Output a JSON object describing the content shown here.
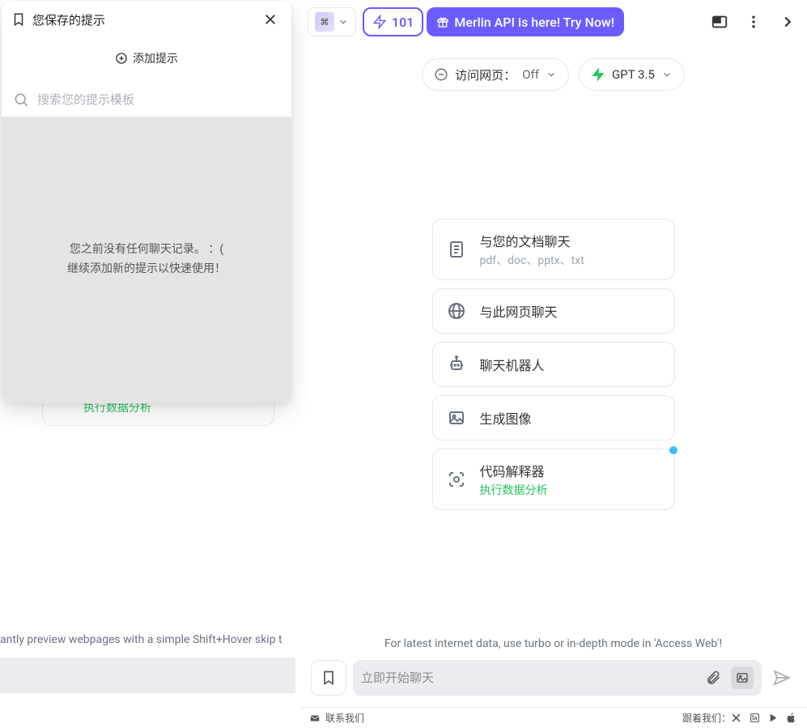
{
  "popup": {
    "title": "您保存的提示",
    "add_label": "添加提示",
    "search_placeholder": "搜索您的提示模板",
    "empty_line1": "您之前没有任何聊天记录。 ：(",
    "empty_line2": "继续添加新的提示以快速使用！"
  },
  "under": {
    "green_sub": "执行数据分析",
    "tip": "antly preview webpages with a simple  Shift+Hover  skip t"
  },
  "header": {
    "credits": "101",
    "promo": "Merlin API is here! Try Now!"
  },
  "subheader": {
    "access_web_label": "访问网页：",
    "access_web_value": "Off",
    "model": "GPT 3.5"
  },
  "cards": {
    "doc_title": "与您的文档聊天",
    "doc_sub": "pdf、doc、pptx、txt",
    "web_title": "与此网页聊天",
    "bot_title": "聊天机器人",
    "image_title": "生成图像",
    "code_title": "代码解释器",
    "code_sub": "执行数据分析"
  },
  "tip": "For latest internet data, use turbo or in-depth mode in 'Access Web'!",
  "composer": {
    "placeholder": "立即开始聊天"
  },
  "footer": {
    "contact": "联系我们",
    "follow": "跟着我们："
  }
}
